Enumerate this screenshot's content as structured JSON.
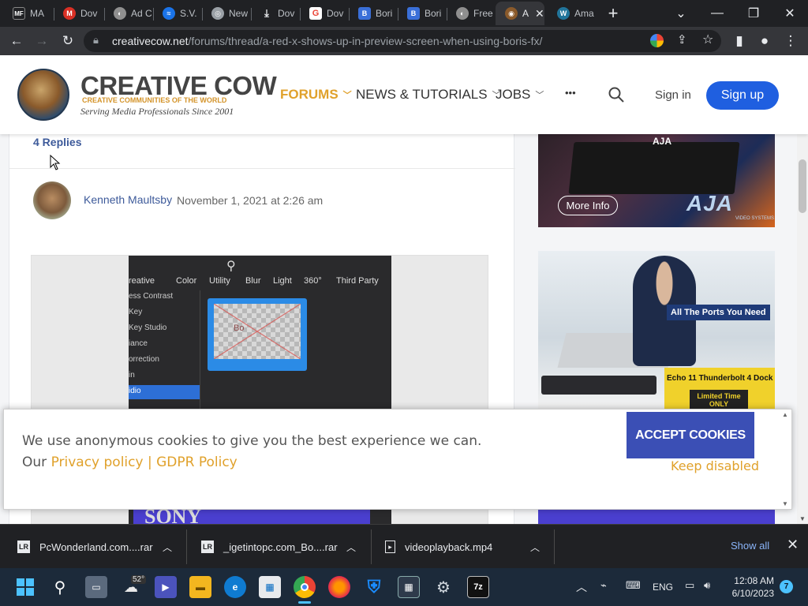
{
  "browser": {
    "tabs": [
      {
        "label": "MA",
        "favicon": "mf-icon",
        "active": false
      },
      {
        "label": "Dov",
        "favicon": "gmail-icon",
        "active": false
      },
      {
        "label": "Ad C",
        "favicon": "globe-icon",
        "active": false
      },
      {
        "label": "S.V.",
        "favicon": "sv-icon",
        "active": false
      },
      {
        "label": "New",
        "favicon": "chrome-icon",
        "active": false
      },
      {
        "label": "Dov",
        "favicon": "download-icon",
        "active": false
      },
      {
        "label": "Dov",
        "favicon": "g-icon",
        "active": false
      },
      {
        "label": "Bori",
        "favicon": "boris-icon",
        "active": false
      },
      {
        "label": "Bori",
        "favicon": "boris-icon",
        "active": false
      },
      {
        "label": "Free",
        "favicon": "globe-icon",
        "active": false
      },
      {
        "label": "A",
        "favicon": "cow-icon",
        "active": true
      },
      {
        "label": "Ama",
        "favicon": "wordpress-icon",
        "active": false
      }
    ],
    "url_domain": "creativecow.net",
    "url_path": "/forums/thread/a-red-x-shows-up-in-preview-screen-when-using-boris-fx/"
  },
  "site": {
    "brand": "CREATIVE COW",
    "brand_tagline": "CREATIVE COMMUNITIES OF THE WORLD",
    "brand_slogan": "Serving Media Professionals Since 2001",
    "nav": {
      "forums": "FORUMS",
      "news": "NEWS & TUTORIALS",
      "jobs": "JOBS",
      "more": "•••"
    },
    "signin": "Sign in",
    "signup": "Sign up",
    "accent_color": "#e0a12b",
    "button_color": "#1f5fe0"
  },
  "thread": {
    "replies": "4 Replies",
    "author": "Kenneth Maultsby",
    "date": "November 1, 2021 at 2:26 am",
    "screenshot": {
      "tabs": [
        "reative",
        "Color",
        "Utility",
        "Blur",
        "Light",
        "360°",
        "Third Party"
      ],
      "sidebar": [
        "ess Contrast",
        "Key",
        "Key Studio",
        "iance",
        "orrection",
        "in",
        "idio"
      ],
      "preview_label": "Bo"
    }
  },
  "ads": {
    "aja_more_info": "More Info",
    "aja_logo": "AJA",
    "aja_device_label": "AJA",
    "aja_subtitle": "VIDEO SYSTEMS",
    "owc_tag": "All The Ports You Need",
    "owc_product": "Echo 11 Thunderbolt 4 Dock",
    "owc_limited": "Limited Time ONLY",
    "sony": "SONY"
  },
  "cookie": {
    "line1": "We use anonymous cookies to give you the best experience we can.",
    "our": "Our",
    "privacy": "Privacy policy",
    "sep": "|",
    "gdpr": "GDPR Policy",
    "accept": "ACCEPT COOKIES",
    "keep": "Keep disabled"
  },
  "downloads": {
    "items": [
      {
        "name": "PcWonderland.com....rar"
      },
      {
        "name": "_igetintopc.com_Bo....rar"
      },
      {
        "name": "videoplayback.mp4"
      }
    ],
    "show_all": "Show all"
  },
  "taskbar": {
    "weather": "52°",
    "lang": "ENG",
    "time": "12:08 AM",
    "date": "6/10/2023",
    "badge": "7"
  }
}
